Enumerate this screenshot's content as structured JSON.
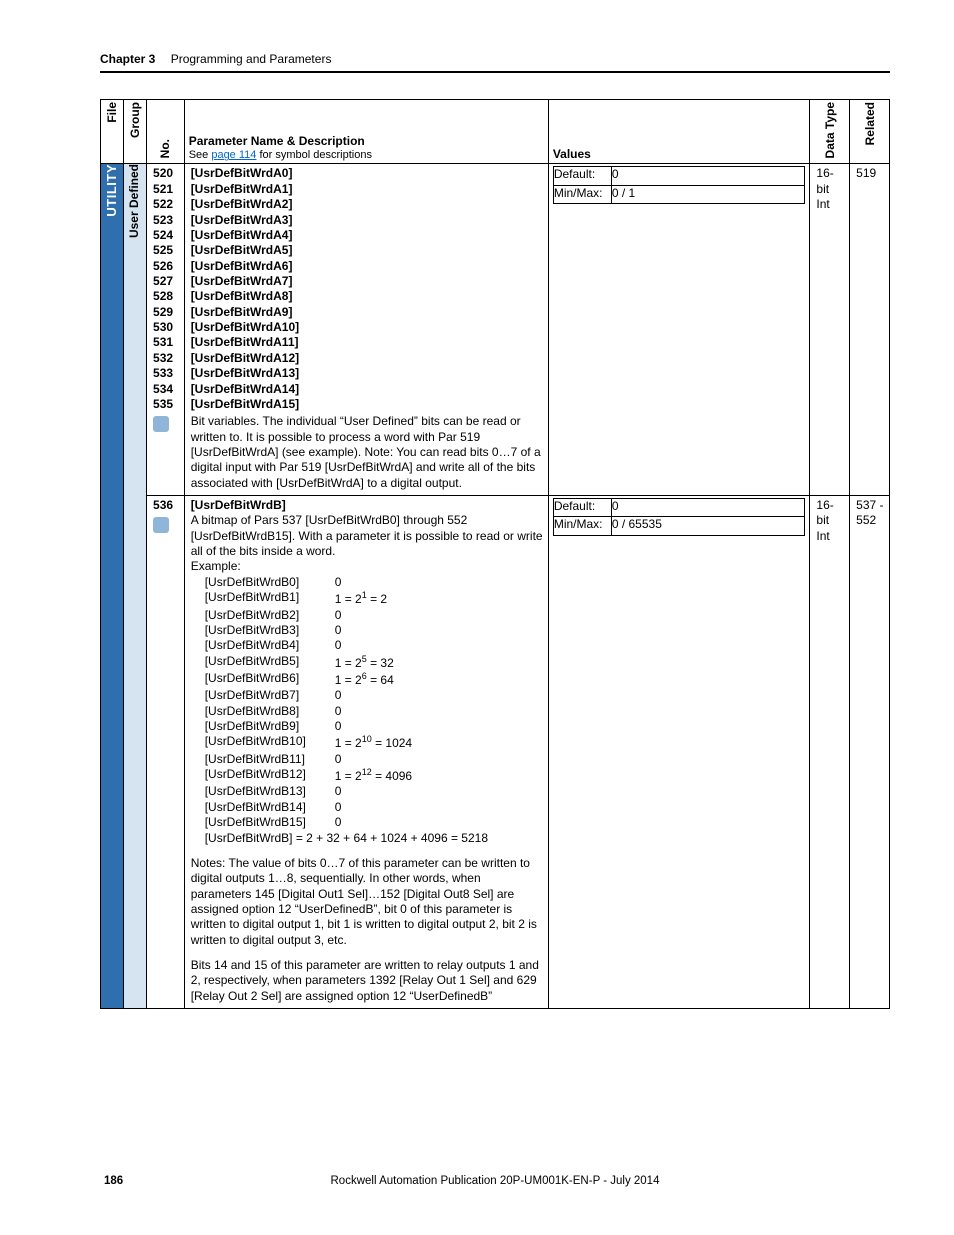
{
  "header": {
    "chapter_label": "Chapter 3",
    "chapter_title": "Programming and Parameters"
  },
  "columns": {
    "file": "File",
    "group": "Group",
    "no": "No.",
    "desc_title": "Parameter Name & Description",
    "desc_sub_pre": "See ",
    "desc_sub_link": "page 114",
    "desc_sub_post": " for symbol descriptions",
    "values": "Values",
    "data_type": "Data Type",
    "related": "Related"
  },
  "file_label": "UTILITY",
  "group_label": "User Defined",
  "row1": {
    "numbers": [
      "520",
      "521",
      "522",
      "523",
      "524",
      "525",
      "526",
      "527",
      "528",
      "529",
      "530",
      "531",
      "532",
      "533",
      "534",
      "535"
    ],
    "names": [
      "[UsrDefBitWrdA0]",
      "[UsrDefBitWrdA1]",
      "[UsrDefBitWrdA2]",
      "[UsrDefBitWrdA3]",
      "[UsrDefBitWrdA4]",
      "[UsrDefBitWrdA5]",
      "[UsrDefBitWrdA6]",
      "[UsrDefBitWrdA7]",
      "[UsrDefBitWrdA8]",
      "[UsrDefBitWrdA9]",
      "[UsrDefBitWrdA10]",
      "[UsrDefBitWrdA11]",
      "[UsrDefBitWrdA12]",
      "[UsrDefBitWrdA13]",
      "[UsrDefBitWrdA14]",
      "[UsrDefBitWrdA15]"
    ],
    "body": "Bit variables. The individual “User Defined” bits can be read or written to. It is possible to process a word with Par 519 [UsrDefBitWrdA] (see example).\nNote: You can read bits 0…7 of a digital input with Par 519 [UsrDefBitWrdA] and write all of the bits associated with [UsrDefBitWrdA] to a digital output.",
    "default_label": "Default:",
    "default_val": "0",
    "minmax_label": "Min/Max:",
    "minmax_val": "0 / 1",
    "dtype1": "16-bit",
    "dtype2": "Int",
    "related": "519"
  },
  "row2": {
    "no": "536",
    "name": "[UsrDefBitWrdB]",
    "lead": "A bitmap of Pars 537 [UsrDefBitWrdB0] through 552 [UsrDefBitWrdB15]. With a parameter it is possible to read or write all of the bits inside a word.",
    "example_label": "Example:",
    "example_lines": [
      {
        "l": "[UsrDefBitWrdB0]",
        "r": "0"
      },
      {
        "l": "[UsrDefBitWrdB1]",
        "r": "1 = 2^1 = 2",
        "sup": "1",
        "base": "1 = 2",
        "eq": " = 2"
      },
      {
        "l": "[UsrDefBitWrdB2]",
        "r": "0"
      },
      {
        "l": "[UsrDefBitWrdB3]",
        "r": "0"
      },
      {
        "l": "[UsrDefBitWrdB4]",
        "r": "0"
      },
      {
        "l": "[UsrDefBitWrdB5]",
        "r": "1 = 2^5 = 32",
        "sup": "5",
        "base": "1 = 2",
        "eq": " = 32"
      },
      {
        "l": "[UsrDefBitWrdB6]",
        "r": "1 = 2^6 = 64",
        "sup": "6",
        "base": "1 = 2",
        "eq": " = 64"
      },
      {
        "l": "[UsrDefBitWrdB7]",
        "r": "0"
      },
      {
        "l": "[UsrDefBitWrdB8]",
        "r": "0"
      },
      {
        "l": "[UsrDefBitWrdB9]",
        "r": "0"
      },
      {
        "l": "[UsrDefBitWrdB10]",
        "r": "1 = 2^10 = 1024",
        "sup": "10",
        "base": "1 = 2",
        "eq": " = 1024"
      },
      {
        "l": "[UsrDefBitWrdB11]",
        "r": "0"
      },
      {
        "l": "[UsrDefBitWrdB12]",
        "r": "1 = 2^12 = 4096",
        "sup": "12",
        "base": "1 = 2",
        "eq": " = 4096"
      },
      {
        "l": "[UsrDefBitWrdB13]",
        "r": "0"
      },
      {
        "l": "[UsrDefBitWrdB14]",
        "r": "0"
      },
      {
        "l": "[UsrDefBitWrdB15]",
        "r": "0"
      }
    ],
    "example_total": "[UsrDefBitWrdB] = 2 + 32 + 64 + 1024 + 4096 = 5218",
    "notes1": "Notes: The value of bits 0…7 of this parameter can be written to digital outputs 1…8, sequentially. In other words, when parameters 145 [Digital Out1 Sel]…152 [Digital Out8 Sel] are assigned option 12 “UserDefinedB”, bit 0 of this parameter is written to digital output 1, bit 1 is written to digital output 2, bit 2 is written to digital output 3, etc.",
    "notes2": "Bits 14 and 15 of this parameter are written to relay outputs 1 and 2, respectively, when parameters 1392 [Relay Out 1 Sel] and 629 [Relay Out 2 Sel] are assigned option 12 “UserDefinedB”",
    "default_label": "Default:",
    "default_val": "0",
    "minmax_label": "Min/Max:",
    "minmax_val": "0 / 65535",
    "dtype1": "16-bit",
    "dtype2": "Int",
    "related": "537 - 552"
  },
  "footer": {
    "page": "186",
    "pub": "Rockwell Automation Publication 20P-UM001K-EN-P - July 2014"
  }
}
